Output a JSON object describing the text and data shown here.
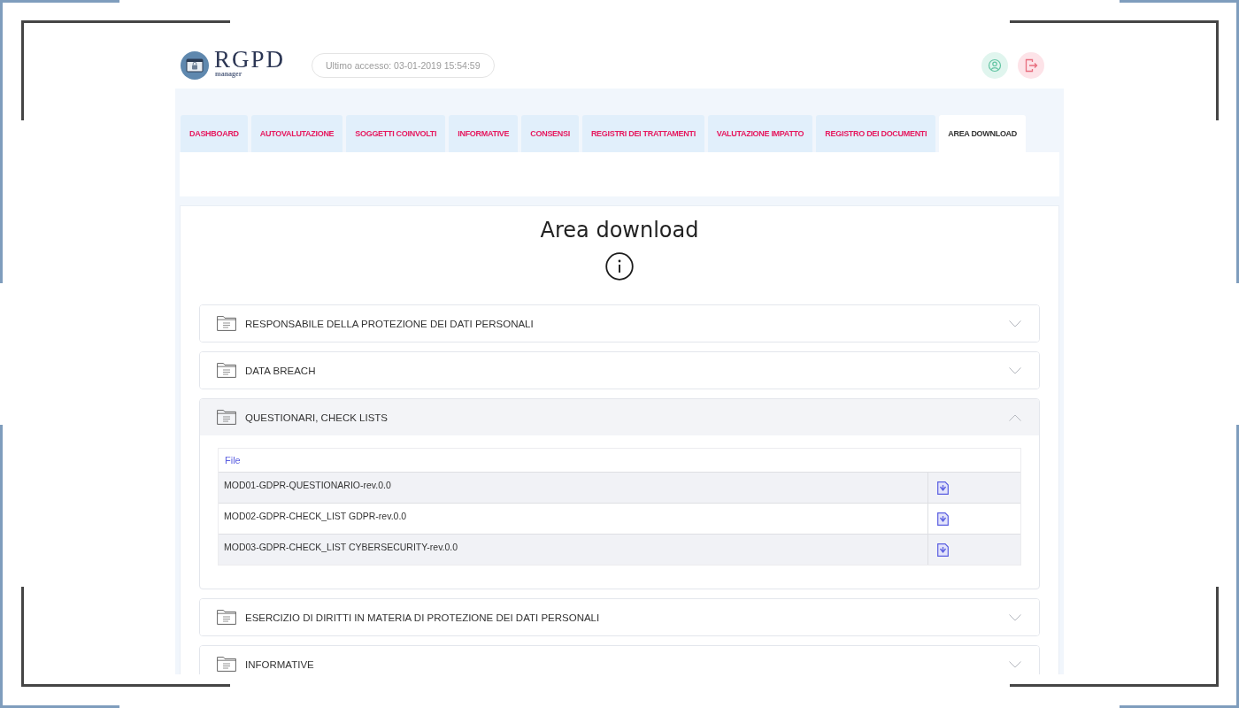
{
  "header": {
    "logo": {
      "title": "RGPD",
      "subtitle": "manager"
    },
    "last_access": "Ultimo accesso: 03-01-2019 15:54:59"
  },
  "tabs": [
    {
      "label": "DASHBOARD",
      "selected": false
    },
    {
      "label": "AUTOVALUTAZIONE",
      "selected": false
    },
    {
      "label": "SOGGETTI COINVOLTI",
      "selected": false
    },
    {
      "label": "INFORMATIVE",
      "selected": false
    },
    {
      "label": "CONSENSI",
      "selected": false
    },
    {
      "label": "REGISTRI DEI TRATTAMENTI",
      "selected": false
    },
    {
      "label": "VALUTAZIONE IMPATTO",
      "selected": false
    },
    {
      "label": "REGISTRO DEI DOCUMENTI",
      "selected": false
    },
    {
      "label": "AREA DOWNLOAD",
      "selected": true
    }
  ],
  "page_title": "Area download",
  "sections": [
    {
      "title": "RESPONSABILE DELLA PROTEZIONE DEI DATI PERSONALI",
      "expanded": false
    },
    {
      "title": "DATA BREACH",
      "expanded": false
    },
    {
      "title": "QUESTIONARI, CHECK LISTS",
      "expanded": true,
      "files": {
        "columns": [
          "File"
        ],
        "rows": [
          {
            "file": "MOD01-GDPR-QUESTIONARIO-rev.0.0"
          },
          {
            "file": "MOD02-GDPR-CHECK_LIST GDPR-rev.0.0"
          },
          {
            "file": "MOD03-GDPR-CHECK_LIST CYBERSECURITY-rev.0.0"
          }
        ]
      }
    },
    {
      "title": "ESERCIZIO DI DIRITTI IN MATERIA DI PROTEZIONE DEI DATI PERSONALI",
      "expanded": false
    },
    {
      "title": "INFORMATIVE",
      "expanded": false
    }
  ]
}
